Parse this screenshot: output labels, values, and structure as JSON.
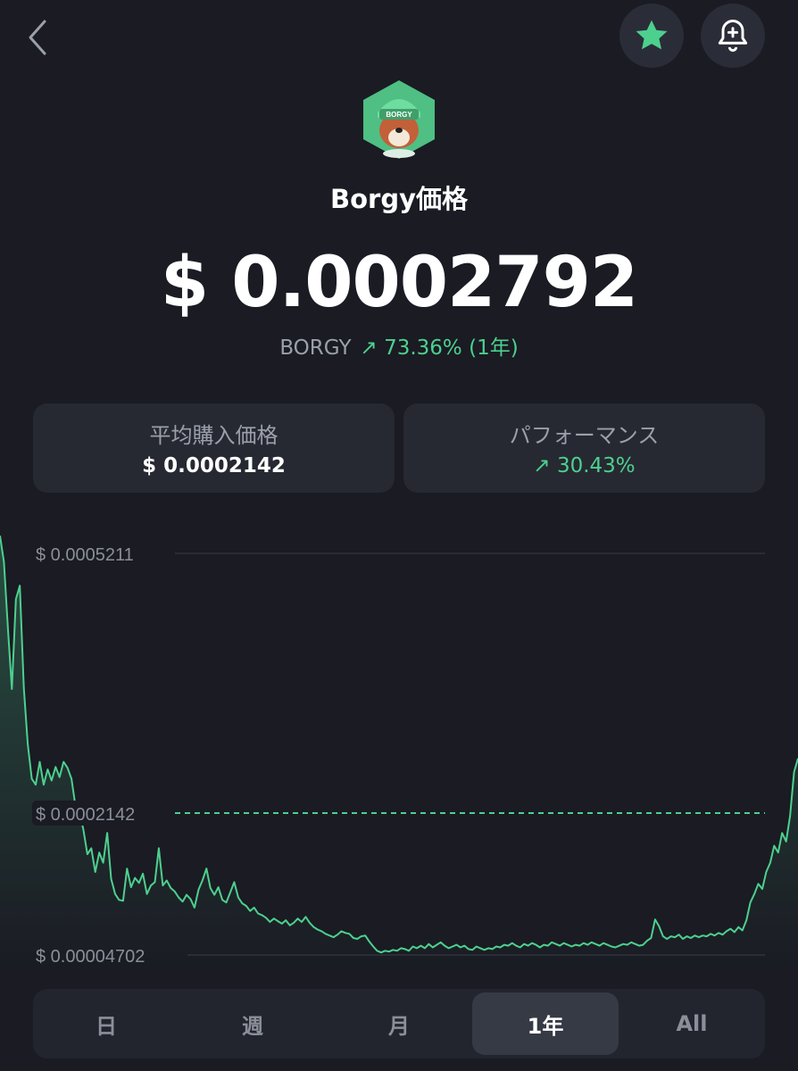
{
  "header": {
    "back_icon": "chevron-left-icon",
    "favorite_icon": "star-icon",
    "alert_icon": "bell-plus-icon"
  },
  "token": {
    "title": "Borgy価格",
    "logo_text": "BORGY",
    "price": "$ 0.0002792",
    "ticker": "BORGY",
    "change": "↗ 73.36% (1年)"
  },
  "cards": {
    "avg_label": "平均購入価格",
    "avg_value": "$ 0.0002142",
    "perf_label": "パフォーマンス",
    "perf_value": "↗ 30.43%"
  },
  "colors": {
    "accent": "#4dd08e",
    "background": "#1a1b23",
    "card": "#262932"
  },
  "chart_data": {
    "type": "line",
    "tick_labels": [
      "$ 0.0005211",
      "$ 0.0002142",
      "$ 0.00004702"
    ],
    "max": 0.0005211,
    "reference": 0.0002142,
    "min": 4.702e-05,
    "values": [
      0.000542,
      0.000511,
      0.000432,
      0.000361,
      0.000467,
      0.000483,
      0.000362,
      0.000296,
      0.000255,
      0.000248,
      0.000275,
      0.000248,
      0.000266,
      0.000253,
      0.000269,
      0.000257,
      0.000275,
      0.000268,
      0.000255,
      0.000223,
      0.000216,
      0.000195,
      0.000166,
      0.000173,
      0.000145,
      0.000168,
      0.000156,
      0.000191,
      0.000137,
      0.000119,
      0.000112,
      0.000111,
      0.000149,
      0.000127,
      0.000138,
      0.000132,
      0.000143,
      0.000119,
      0.000129,
      0.000133,
      0.000173,
      0.000129,
      0.000135,
      0.000126,
      0.000122,
      0.000115,
      0.00011,
      0.000118,
      0.000113,
      0.000103,
      0.000124,
      0.000135,
      0.000149,
      0.000126,
      0.000118,
      0.000127,
      0.000112,
      0.000109,
      0.000121,
      0.000133,
      0.000115,
      0.000108,
      0.000105,
      9.9e-05,
      0.000103,
      9.6e-05,
      9.4e-05,
      9.1e-05,
      8.6e-05,
      9e-05,
      8.7e-05,
      8.4e-05,
      8.8e-05,
      8.2e-05,
      8.5e-05,
      9e-05,
      8.6e-05,
      9.2e-05,
      8.5e-05,
      8e-05,
      7.7e-05,
      7.5e-05,
      7.2e-05,
      7e-05,
      6.8e-05,
      7.1e-05,
      7.5e-05,
      7.3e-05,
      7.2e-05,
      6.7e-05,
      6.6e-05,
      6.9e-05,
      7e-05,
      6.3e-05,
      5.7e-05,
      5.2e-05,
      5e-05,
      5.2e-05,
      5.1e-05,
      5.3e-05,
      5.2e-05,
      5.5e-05,
      5.4e-05,
      5.2e-05,
      5.7e-05,
      5.5e-05,
      5.8e-05,
      5.5e-05,
      6e-05,
      5.6e-05,
      5.9e-05,
      6.2e-05,
      5.8e-05,
      5.5e-05,
      5.7e-05,
      5.9e-05,
      5.6e-05,
      5.8e-05,
      5.4e-05,
      5.3e-05,
      5.7e-05,
      5.5e-05,
      5.3e-05,
      5.5e-05,
      5.4e-05,
      5.7e-05,
      5.6e-05,
      5.9e-05,
      5.8e-05,
      6.1e-05,
      5.8e-05,
      5.6e-05,
      6e-05,
      5.8e-05,
      6.1e-05,
      5.9e-05,
      5.6e-05,
      5.9e-05,
      5.8e-05,
      6.2e-05,
      6e-05,
      5.8e-05,
      6.1e-05,
      5.9e-05,
      5.7e-05,
      5.9e-05,
      5.8e-05,
      6.1e-05,
      5.9e-05,
      6.2e-05,
      6e-05,
      5.8e-05,
      6.1e-05,
      5.9e-05,
      5.7e-05,
      5.6e-05,
      5.8e-05,
      6e-05,
      5.9e-05,
      6.2e-05,
      6e-05,
      5.8e-05,
      5.9e-05,
      6.4e-05,
      6.7e-05,
      8.9e-05,
      8.1e-05,
      6.9e-05,
      6.6e-05,
      6.9e-05,
      6.8e-05,
      7.1e-05,
      6.6e-05,
      6.9e-05,
      6.7e-05,
      7e-05,
      6.8e-05,
      7e-05,
      6.9e-05,
      7.2e-05,
      7e-05,
      7.3e-05,
      7.1e-05,
      7.5e-05,
      7.8e-05,
      7.4e-05,
      8e-05,
      7.6e-05,
      8.8e-05,
      0.000109,
      0.000119,
      0.000131,
      0.000125,
      0.000145,
      0.000156,
      0.000176,
      0.000168,
      0.000191,
      0.000181,
      0.000211,
      0.000263,
      0.000279
    ]
  },
  "timeframes": [
    {
      "label": "日",
      "active": false
    },
    {
      "label": "週",
      "active": false
    },
    {
      "label": "月",
      "active": false
    },
    {
      "label": "1年",
      "active": true
    },
    {
      "label": "All",
      "active": false
    }
  ]
}
